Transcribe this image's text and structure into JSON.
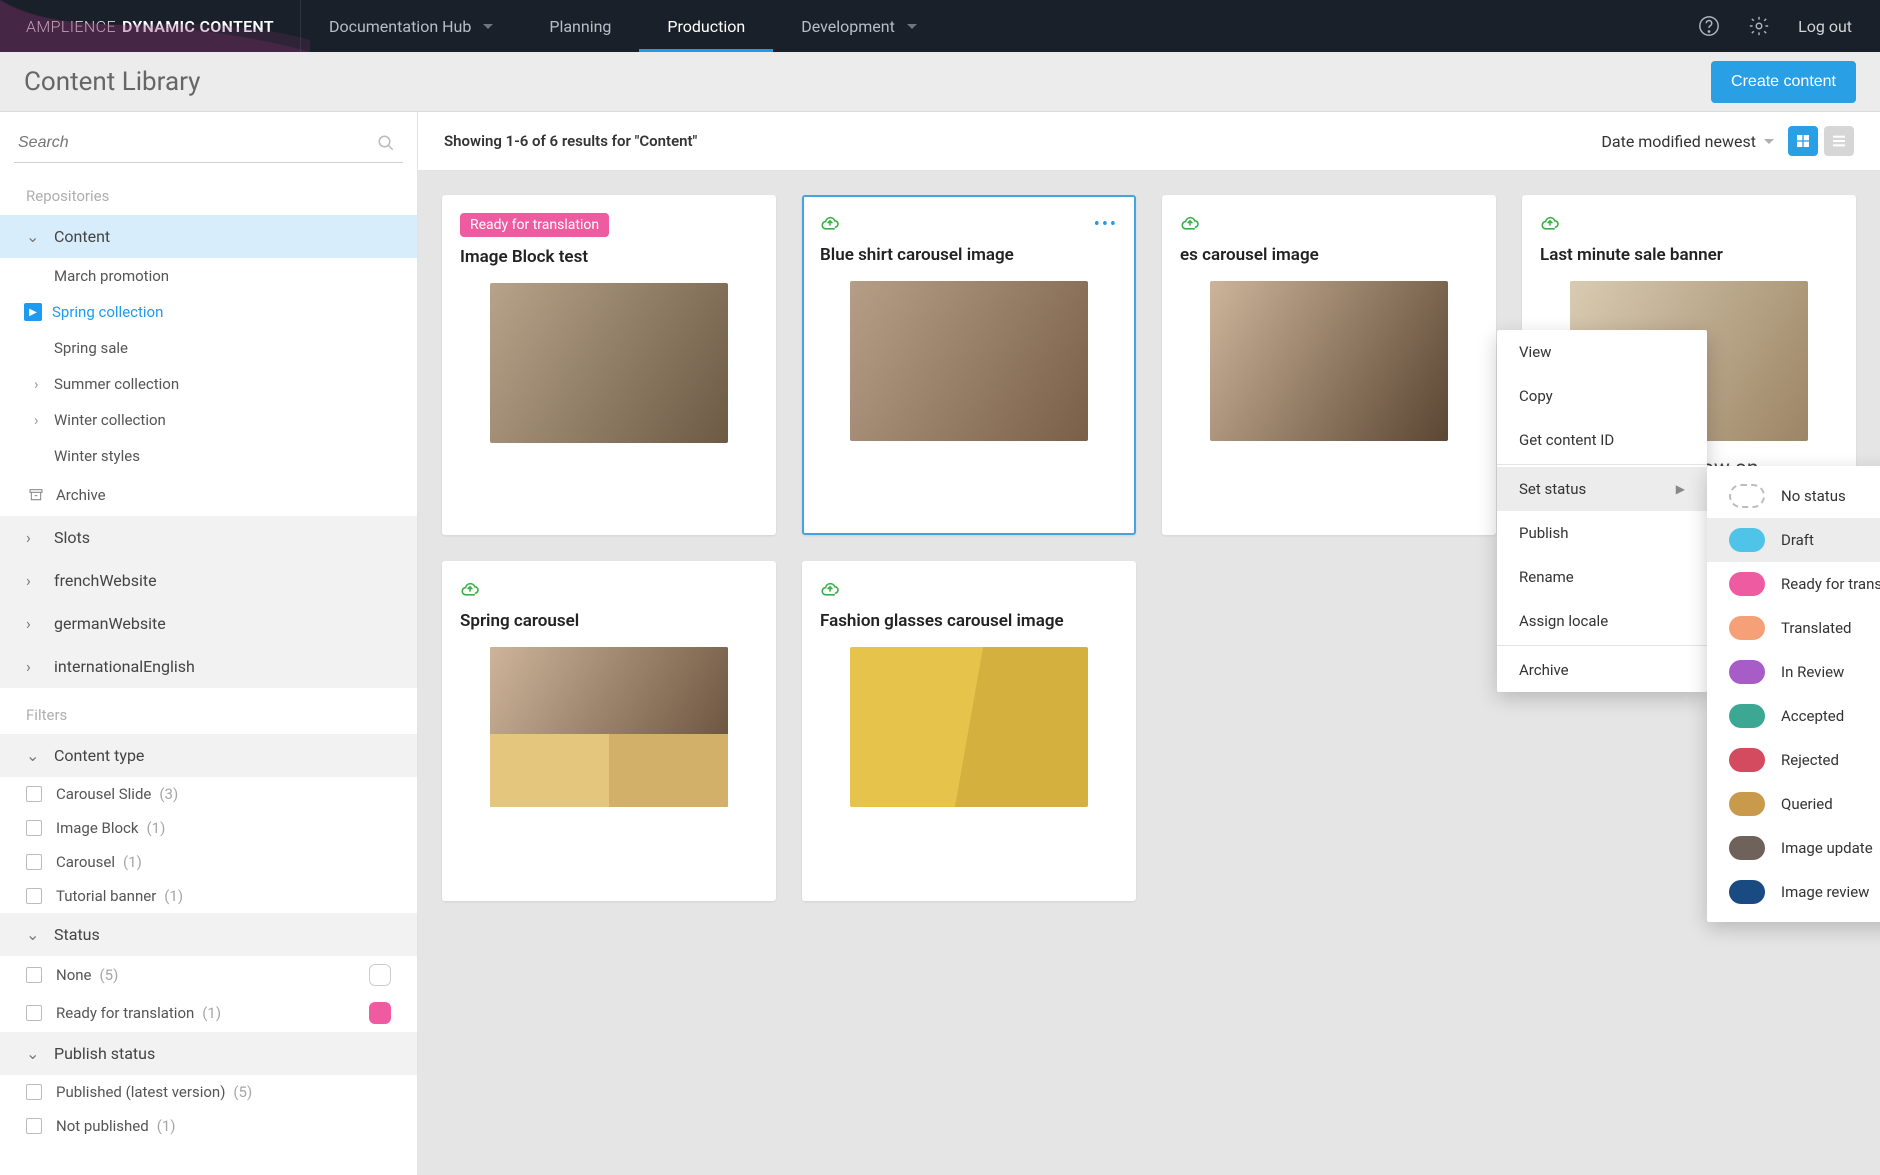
{
  "topbar": {
    "brand1": "AMPLIENCE",
    "brand2": "DYNAMIC CONTENT",
    "tabs": [
      "Documentation Hub",
      "Planning",
      "Production",
      "Development"
    ],
    "logout": "Log out"
  },
  "subhead": {
    "title": "Content Library",
    "create_btn": "Create content"
  },
  "search": {
    "placeholder": "Search"
  },
  "sidebar": {
    "repos_label": "Repositories",
    "content": "Content",
    "tree": [
      {
        "label": "March promotion",
        "children": false,
        "selected": false
      },
      {
        "label": "Spring collection",
        "children": false,
        "selected": true
      },
      {
        "label": "Spring sale",
        "children": false,
        "selected": false
      },
      {
        "label": "Summer collection",
        "children": true,
        "selected": false
      },
      {
        "label": "Winter collection",
        "children": true,
        "selected": false
      },
      {
        "label": "Winter styles",
        "children": false,
        "selected": false
      }
    ],
    "archive": "Archive",
    "sections": [
      "Slots",
      "frenchWebsite",
      "germanWebsite",
      "internationalEnglish"
    ],
    "filters_label": "Filters",
    "content_type_label": "Content type",
    "content_types": [
      {
        "label": "Carousel Slide",
        "count": "(3)"
      },
      {
        "label": "Image Block",
        "count": "(1)"
      },
      {
        "label": "Carousel",
        "count": "(1)"
      },
      {
        "label": "Tutorial banner",
        "count": "(1)"
      }
    ],
    "status_label": "Status",
    "statuses": [
      {
        "label": "None",
        "count": "(5)",
        "swatch": "#ffffff",
        "border": "#cccccc"
      },
      {
        "label": "Ready for translation",
        "count": "(1)",
        "swatch": "#ef5ba1",
        "border": "#ef5ba1"
      }
    ],
    "publish_status_label": "Publish status",
    "publish_statuses": [
      {
        "label": "Published (latest version)",
        "count": "(5)"
      },
      {
        "label": "Not published",
        "count": "(1)"
      }
    ]
  },
  "content_bar": {
    "results": "Showing 1-6 of 6 results for \"Content\"",
    "sort": "Date modified newest"
  },
  "cards": [
    {
      "title": "Image Block test",
      "badge": "Ready for translation",
      "cloud": false
    },
    {
      "title": "Blue shirt carousel image",
      "badge": null,
      "cloud": true
    },
    {
      "title": "es carousel image",
      "badge": null,
      "cloud": true
    },
    {
      "title": "Last minute sale banner",
      "badge": null,
      "cloud": true,
      "caption": "se sale now on"
    },
    {
      "title": "Spring carousel",
      "badge": null,
      "cloud": true
    },
    {
      "title": "Fashion glasses carousel image",
      "badge": null,
      "cloud": true
    }
  ],
  "menu": {
    "items": [
      "View",
      "Copy",
      "Get content ID"
    ],
    "set_status": "Set status",
    "publish": "Publish",
    "rename": "Rename",
    "assign_locale": "Assign locale",
    "archive": "Archive"
  },
  "status_menu": [
    {
      "label": "No status",
      "color": "none"
    },
    {
      "label": "Draft",
      "color": "#4fc3e8"
    },
    {
      "label": "Ready for translation",
      "color": "#ef5ba1"
    },
    {
      "label": "Translated",
      "color": "#f5a077"
    },
    {
      "label": "In Review",
      "color": "#a85cc7"
    },
    {
      "label": "Accepted",
      "color": "#3ca893"
    },
    {
      "label": "Rejected",
      "color": "#d44a5e"
    },
    {
      "label": "Queried",
      "color": "#c99a4b"
    },
    {
      "label": "Image update",
      "color": "#6e625a"
    },
    {
      "label": "Image review",
      "color": "#1a4a82"
    }
  ]
}
